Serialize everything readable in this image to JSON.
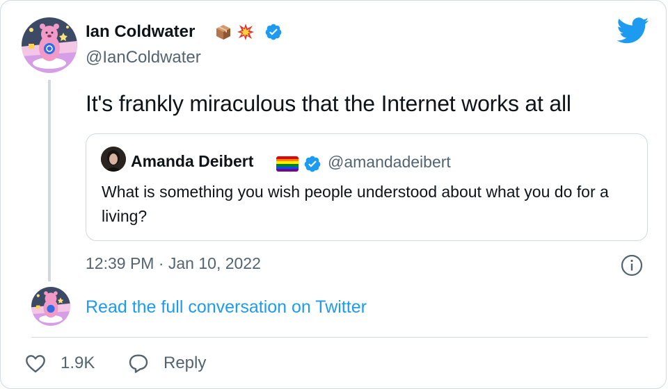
{
  "tweet": {
    "author": {
      "name": "Ian Coldwater",
      "handle": "@IanColdwater",
      "name_emojis": [
        "package-emoji",
        "collision-emoji"
      ],
      "verified": true,
      "avatar": "care-bear-avatar"
    },
    "text": "It's frankly miraculous that the Internet works at all",
    "quoted": {
      "author": {
        "name": "Amanda Deibert",
        "name_emoji": "rainbow-flag-emoji",
        "handle": "@amandadeibert",
        "verified": true
      },
      "text": "What is something you wish people understood about what you do for a living?"
    },
    "timestamp": "12:39 PM · Jan 10, 2022",
    "read_full_label": "Read the full conversation on Twitter",
    "actions": {
      "like_count": "1.9K",
      "reply_label": "Reply"
    }
  },
  "colors": {
    "twitter_blue": "#1d9bf0",
    "secondary_text": "#536471",
    "border": "#cfd9de"
  }
}
